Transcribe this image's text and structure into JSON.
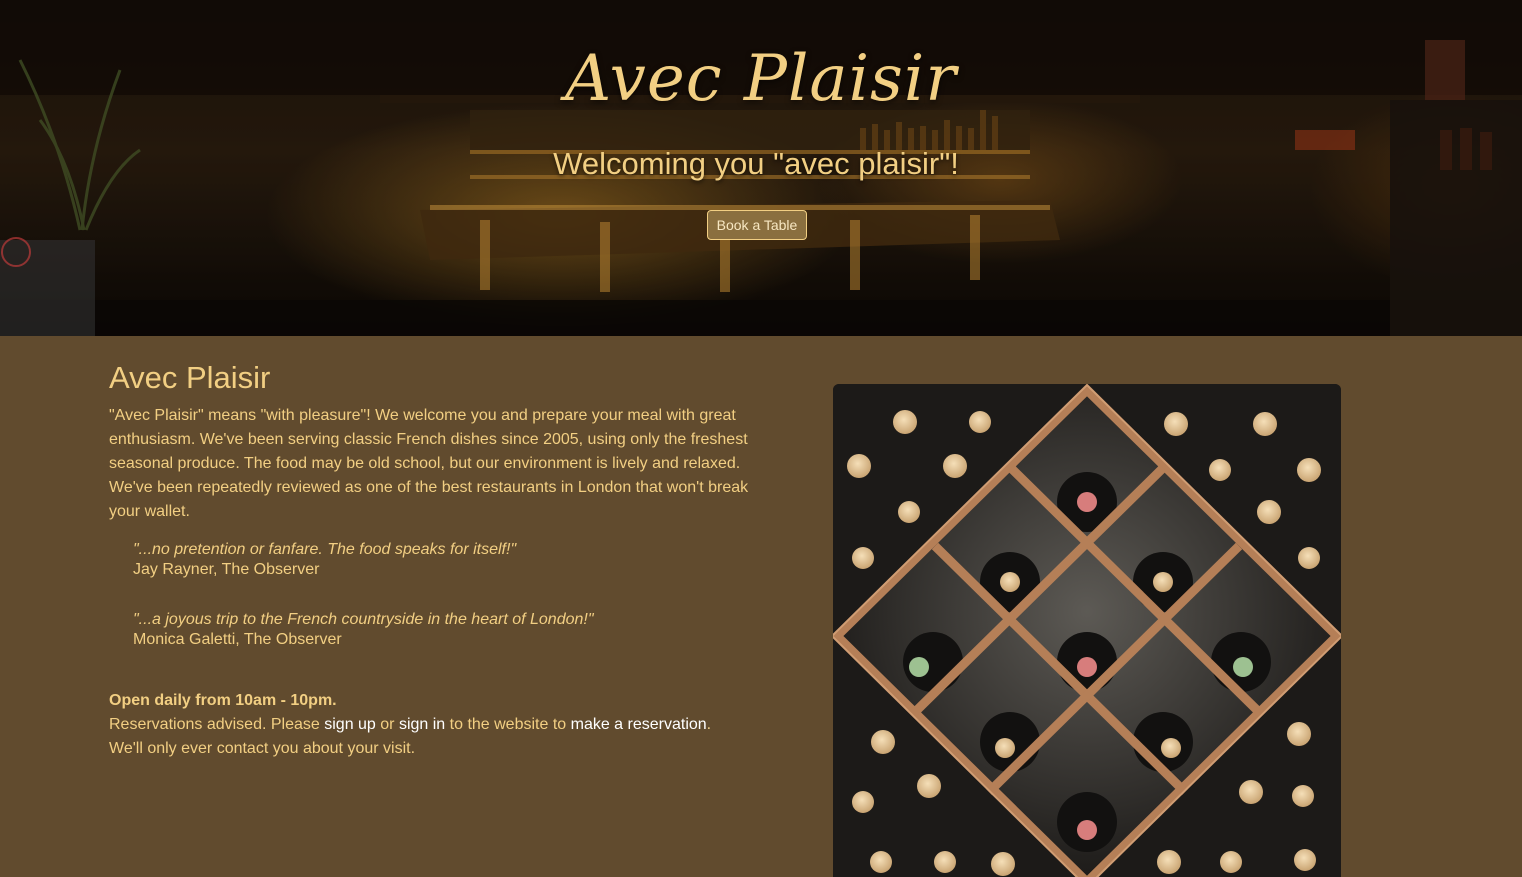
{
  "hero": {
    "title": "Avec Plaisir",
    "subtitle": "Welcoming you \"avec plaisir\"!",
    "book_button": "Book a Table"
  },
  "about": {
    "heading": "Avec Plaisir",
    "description": "\"Avec Plaisir\" means \"with pleasure\"! We welcome you and prepare your meal with great enthusiasm. We've been serving classic French dishes since 2005, using only the freshest seasonal produce. The food may be old school, but our environment is lively and relaxed. We've been repeatedly reviewed as one of the best restaurants in London that won't break your wallet.",
    "quotes": [
      {
        "text": "\"...no pretention or fanfare. The food speaks for itself!\"",
        "author": "Jay Rayner, The Observer"
      },
      {
        "text": "\"...a joyous trip to the French countryside in the heart of London!\"",
        "author": "Monica Galetti, The Observer"
      }
    ],
    "hours": "Open daily from 10am - 10pm.",
    "reserve": {
      "prefix": "Reservations advised. Please ",
      "sign_up": "sign up",
      "or": " or ",
      "sign_in": "sign in",
      "to_site": " to the website to ",
      "make_reservation": "make a reservation",
      "suffix": ". We'll only ever contact you about your visit."
    }
  },
  "colors": {
    "background": "#614b2e",
    "accent_text": "#f2cf83",
    "link": "#ffffff"
  }
}
